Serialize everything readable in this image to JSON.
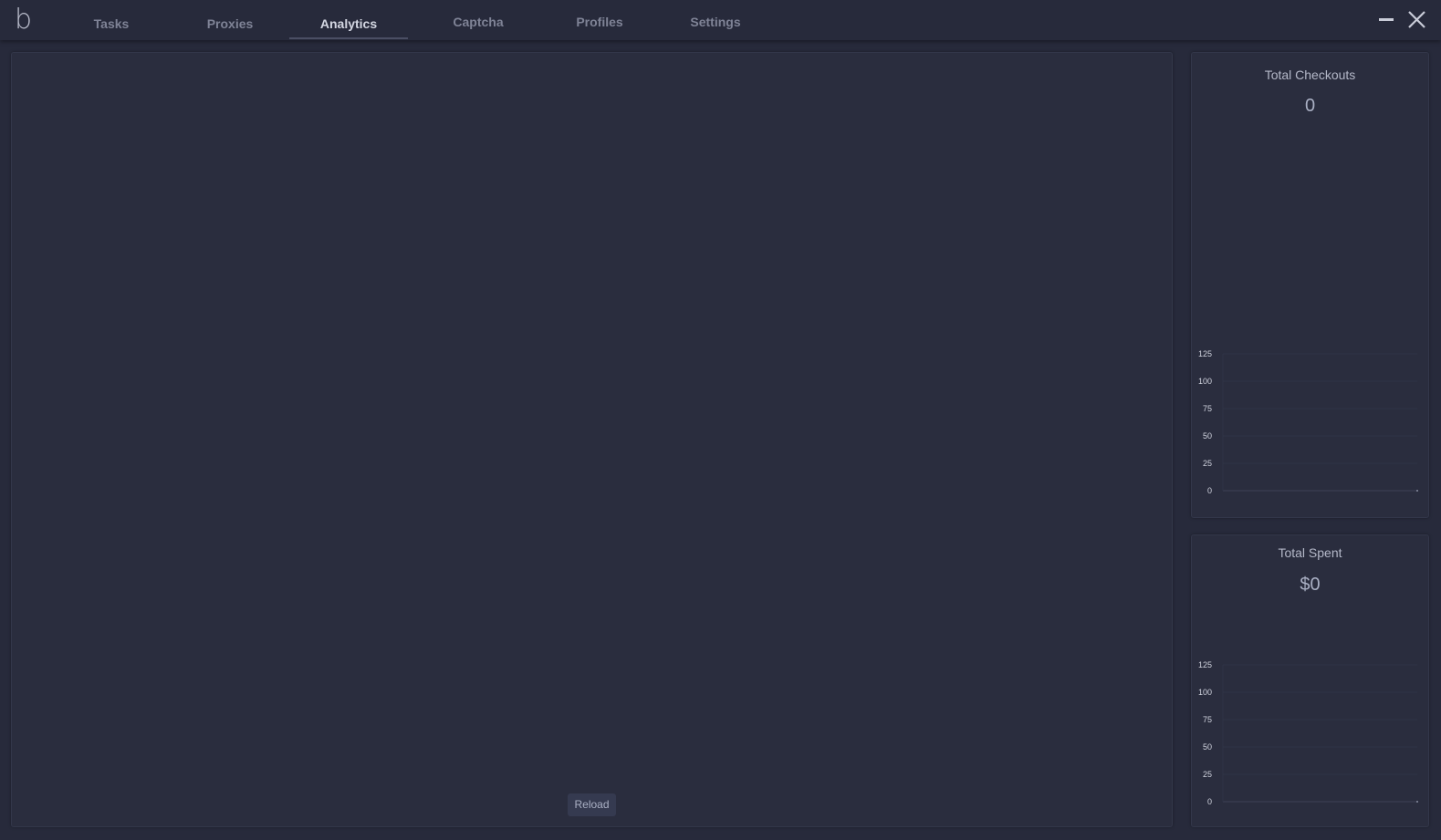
{
  "app": {
    "logo": "b"
  },
  "nav": {
    "tabs": [
      {
        "label": "Tasks"
      },
      {
        "label": "Proxies"
      },
      {
        "label": "Analytics"
      },
      {
        "label": "Captcha"
      },
      {
        "label": "Profiles"
      },
      {
        "label": "Settings"
      }
    ],
    "active_tab": "Analytics"
  },
  "main": {
    "reload_label": "Reload"
  },
  "stats": {
    "checkouts": {
      "title": "Total Checkouts",
      "value": "0"
    },
    "spent": {
      "title": "Total Spent",
      "value": "$0"
    }
  },
  "colors": {
    "background": "#272a3b",
    "panel": "#2a2d3e",
    "active_tab_text": "#d4d7e2",
    "inactive_tab_text": "#7f8396"
  },
  "chart_data": [
    {
      "type": "line",
      "title": "",
      "xlabel": "",
      "ylabel": "",
      "y_ticks": [
        0,
        25,
        50,
        75,
        100,
        125
      ],
      "ylim": [
        0,
        125
      ],
      "series": [
        {
          "values": [
            0
          ]
        }
      ],
      "grid": true
    },
    {
      "type": "line",
      "title": "",
      "xlabel": "",
      "ylabel": "",
      "y_ticks": [
        0,
        25,
        50,
        75,
        100,
        125
      ],
      "ylim": [
        0,
        125
      ],
      "series": [
        {
          "values": [
            0
          ]
        }
      ],
      "grid": true
    }
  ]
}
